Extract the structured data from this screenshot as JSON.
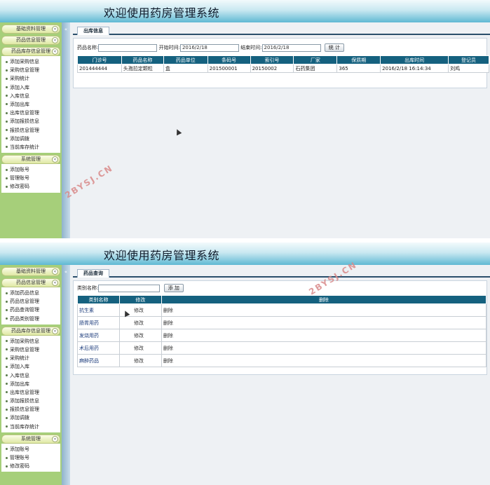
{
  "app_title": "欢迎使用药房管理系统",
  "collapse_glyph": "«",
  "toggle_glyph": "«",
  "watermark": "2BYSJ.CN",
  "panel1": {
    "sidebar": {
      "groups": [
        {
          "label": "基础资料管理",
          "items": []
        },
        {
          "label": "药品信息管理",
          "items": []
        },
        {
          "label": "药品库存信息管理",
          "items": [
            "添加采购信息",
            "采购信息管理",
            "采购统计",
            "添加入库",
            "入库信息",
            "添加出库",
            "出库信息管理",
            "添加报损信息",
            "报损信息管理",
            "添加调拨",
            "当前库存统计"
          ]
        },
        {
          "label": "系统管理",
          "items": [
            "添加账号",
            "管理账号",
            "修改密码"
          ]
        }
      ]
    },
    "tab_label": "出库信息",
    "form": {
      "name_label": "药品名称:",
      "name_value": "",
      "start_label": "开始时间:",
      "start_value": "2016/2/18",
      "end_label": "结束时间:",
      "end_value": "2016/2/18",
      "submit_label": "统 计"
    },
    "table": {
      "columns": [
        "门诊号",
        "药品名称",
        "药品单位",
        "条码号",
        "索引号",
        "厂家",
        "保质期",
        "出库时间",
        "登记员"
      ],
      "rows": [
        [
          "201444444",
          "头孢拉定颗粒",
          "盒",
          "201500001",
          "20150002",
          "石药集团",
          "365",
          "2016/2/18 16:14:34",
          "刘鸡"
        ]
      ]
    }
  },
  "panel2": {
    "sidebar": {
      "groups": [
        {
          "label": "基础资料管理",
          "items": []
        },
        {
          "label": "药品信息管理",
          "items": [
            "添加药品信息",
            "药品信息管理",
            "药品查询管理",
            "药品类别管理"
          ]
        },
        {
          "label": "药品库存信息管理",
          "items": [
            "添加采购信息",
            "采购信息管理",
            "采购统计",
            "添加入库",
            "入库信息",
            "添加出库",
            "出库信息管理",
            "添加报损信息",
            "报损信息管理",
            "添加调拨",
            "当前库存统计"
          ]
        },
        {
          "label": "系统管理",
          "items": [
            "添加账号",
            "管理账号",
            "修改密码"
          ]
        }
      ]
    },
    "tab_label": "药品查询",
    "form": {
      "category_label": "类别名称:",
      "category_value": "",
      "add_label": "添 加"
    },
    "table": {
      "columns": [
        "类别名称",
        "修改",
        "删除"
      ],
      "rows": [
        [
          "抗生素",
          "修改",
          "删除"
        ],
        [
          "肠胃用药",
          "修改",
          "删除"
        ],
        [
          "发烧用药",
          "修改",
          "删除"
        ],
        [
          "术后用药",
          "修改",
          "删除"
        ],
        [
          "麻醉药品",
          "修改",
          "删除"
        ]
      ]
    }
  }
}
